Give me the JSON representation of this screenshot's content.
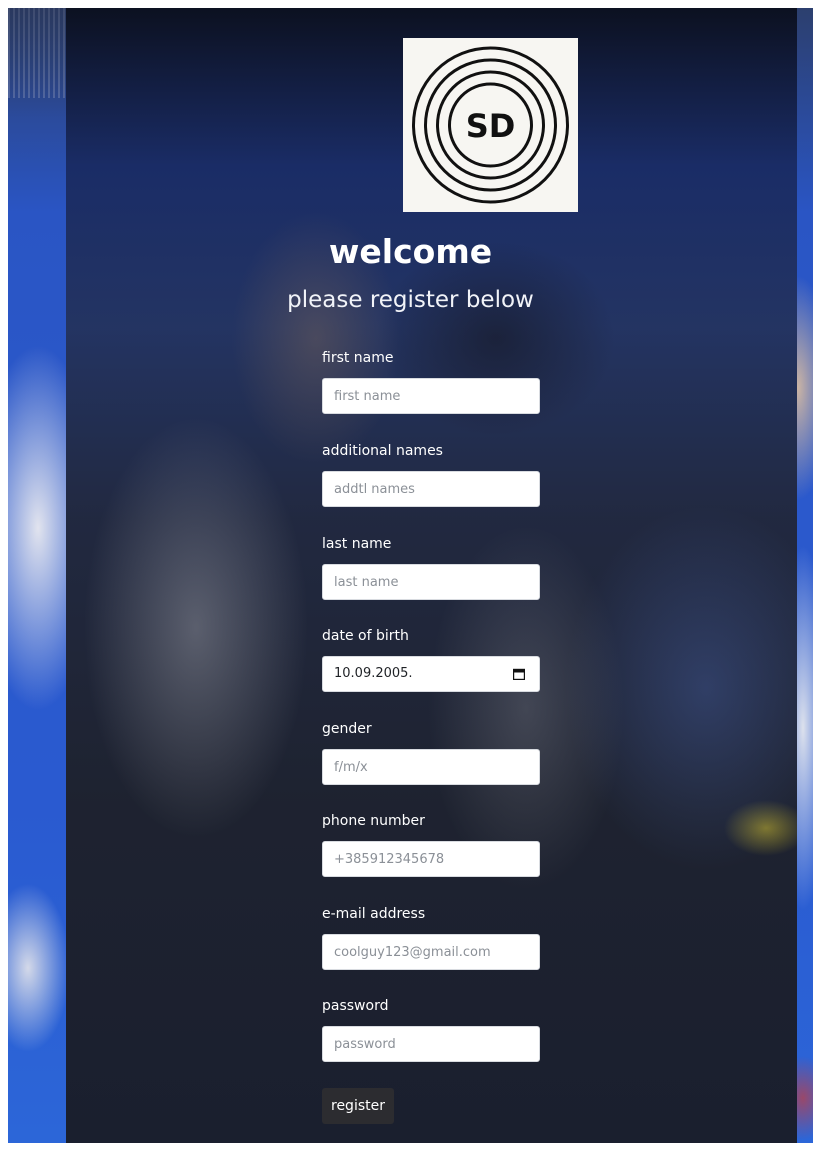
{
  "page": {
    "title": "welcome",
    "subtitle": "please register below"
  },
  "logo": {
    "text": "SD",
    "icon": "target-rings-logo"
  },
  "form": {
    "first_name": {
      "label": "first name",
      "placeholder": "first name"
    },
    "additional_names": {
      "label": "additional names",
      "placeholder": "addtl names"
    },
    "last_name": {
      "label": "last name",
      "placeholder": "last name"
    },
    "date_of_birth": {
      "label": "date of birth",
      "value": "10.09.2005.",
      "icon": "calendar-icon"
    },
    "gender": {
      "label": "gender",
      "placeholder": "f/m/x"
    },
    "phone_number": {
      "label": "phone number",
      "placeholder": "+385912345678"
    },
    "email": {
      "label": "e-mail address",
      "placeholder": "coolguy123@gmail.com"
    },
    "password": {
      "label": "password",
      "placeholder": "password"
    },
    "submit_label": "register"
  },
  "colors": {
    "panel": "#1e2a48",
    "background_blue": "#2b59cc",
    "button": "#2c2c30",
    "text": "#ffffff"
  }
}
